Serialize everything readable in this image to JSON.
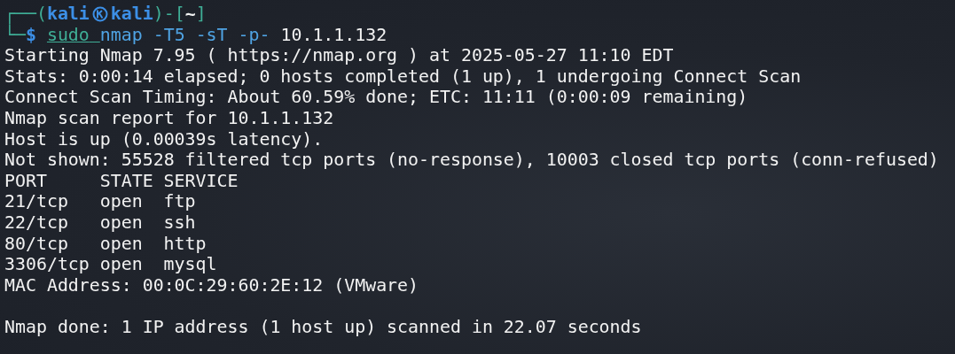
{
  "prompt": {
    "open": "┌──(",
    "user": "kali",
    "host": "kali",
    "mid": ")-[",
    "cwd": "~",
    "close": "]",
    "corner": "└─",
    "sign": "$"
  },
  "command": [
    {
      "kind": "sudo",
      "text": "sudo"
    },
    {
      "kind": "word",
      "text": "nmap"
    },
    {
      "kind": "word",
      "text": "-T5"
    },
    {
      "kind": "word",
      "text": "-sT"
    },
    {
      "kind": "word",
      "text": "-p-"
    },
    {
      "kind": "target",
      "text": "10.1.1.132"
    }
  ],
  "output": [
    "Starting Nmap 7.95 ( https://nmap.org ) at 2025-05-27 11:10 EDT",
    "Stats: 0:00:14 elapsed; 0 hosts completed (1 up), 1 undergoing Connect Scan",
    "Connect Scan Timing: About 60.59% done; ETC: 11:11 (0:00:09 remaining)",
    "Nmap scan report for 10.1.1.132",
    "Host is up (0.00039s latency).",
    "Not shown: 55528 filtered tcp ports (no-response), 10003 closed tcp ports (conn-refused)"
  ],
  "ports": {
    "columns": [
      "PORT",
      "STATE",
      "SERVICE"
    ],
    "rows": [
      [
        "21/tcp",
        "open",
        "ftp"
      ],
      [
        "22/tcp",
        "open",
        "ssh"
      ],
      [
        "80/tcp",
        "open",
        "http"
      ],
      [
        "3306/tcp",
        "open",
        "mysql"
      ]
    ]
  },
  "mac": "MAC Address: 00:0C:29:60:2E:12 (VMware)",
  "summary": "Nmap done: 1 IP address (1 host up) scanned in 22.07 seconds"
}
